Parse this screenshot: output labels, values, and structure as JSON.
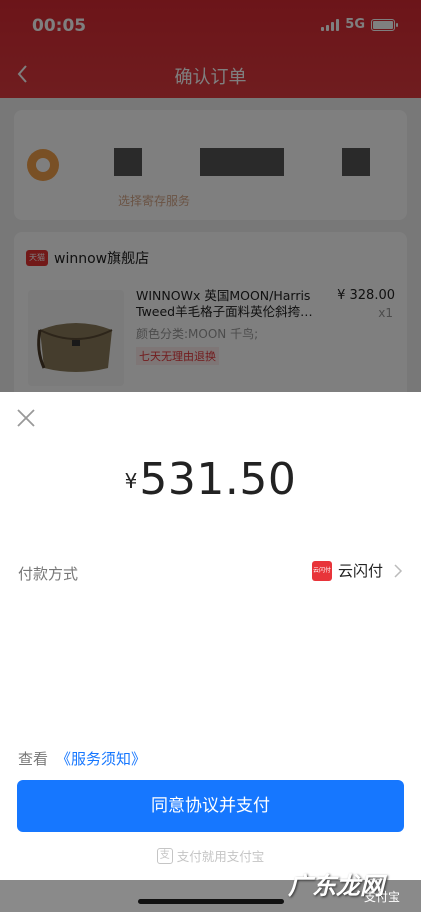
{
  "status_bar": {
    "time": "00:05",
    "network": "5G"
  },
  "nav": {
    "title": "确认订单"
  },
  "background_order": {
    "service_link": "选择寄存服务",
    "store": {
      "badge": "天猫",
      "name": "winnow旗舰店"
    },
    "product": {
      "title": "WINNOWx 英国MOON/Harris Tweed羊毛格子面料英伦斜挎…",
      "sku": "颜色分类:MOON 千鸟;",
      "tag": "七天无理由退换",
      "price": "¥ 328.00",
      "quantity": "x1"
    }
  },
  "payment": {
    "currency_symbol": "¥",
    "amount": "531.50",
    "method_label": "付款方式",
    "method_icon_text": "云闪付",
    "method_name": "云闪付",
    "terms_prefix": "查看",
    "terms_link": "《服务须知》",
    "pay_button": "同意协议并支付",
    "footer": "支付就用支付宝"
  },
  "watermark": {
    "main": "广东龙网",
    "sub": "支付宝"
  },
  "colors": {
    "brand_red": "#d92a33",
    "alipay_blue": "#1677ff",
    "unionpay_red": "#e8343a"
  }
}
